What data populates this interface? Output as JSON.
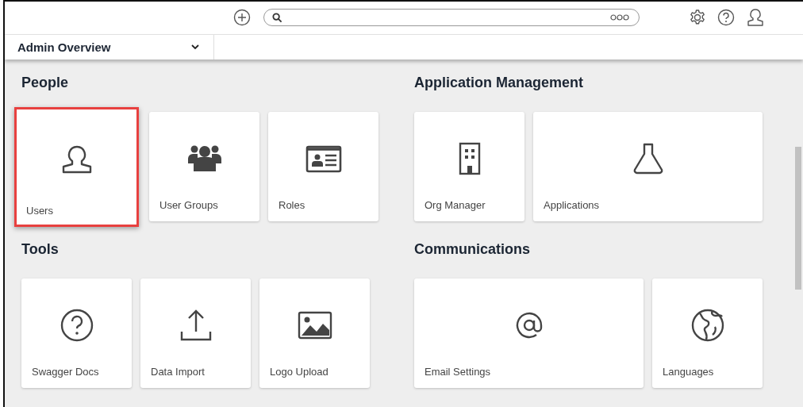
{
  "nav": {
    "title": "Admin Overview"
  },
  "sections": [
    {
      "title": "People",
      "tiles": [
        {
          "label": "Users",
          "kind": "user",
          "wide": false,
          "highlighted": true
        },
        {
          "label": "User Groups",
          "kind": "group",
          "wide": false,
          "highlighted": false
        },
        {
          "label": "Roles",
          "kind": "card",
          "wide": false,
          "highlighted": false
        }
      ]
    },
    {
      "title": "Application Management",
      "tiles": [
        {
          "label": "Org Manager",
          "kind": "building",
          "wide": false,
          "highlighted": false
        },
        {
          "label": "Applications",
          "kind": "flask",
          "wide": true,
          "highlighted": false
        }
      ]
    },
    {
      "title": "Tools",
      "tiles": [
        {
          "label": "Swagger Docs",
          "kind": "help",
          "wide": false,
          "highlighted": false
        },
        {
          "label": "Data Import",
          "kind": "upload",
          "wide": false,
          "highlighted": false
        },
        {
          "label": "Logo Upload",
          "kind": "image",
          "wide": false,
          "highlighted": false
        }
      ]
    },
    {
      "title": "Communications",
      "tiles": [
        {
          "label": "Email Settings",
          "kind": "at",
          "wide": true,
          "highlighted": false
        },
        {
          "label": "Languages",
          "kind": "globe",
          "wide": false,
          "highlighted": false
        }
      ]
    }
  ]
}
